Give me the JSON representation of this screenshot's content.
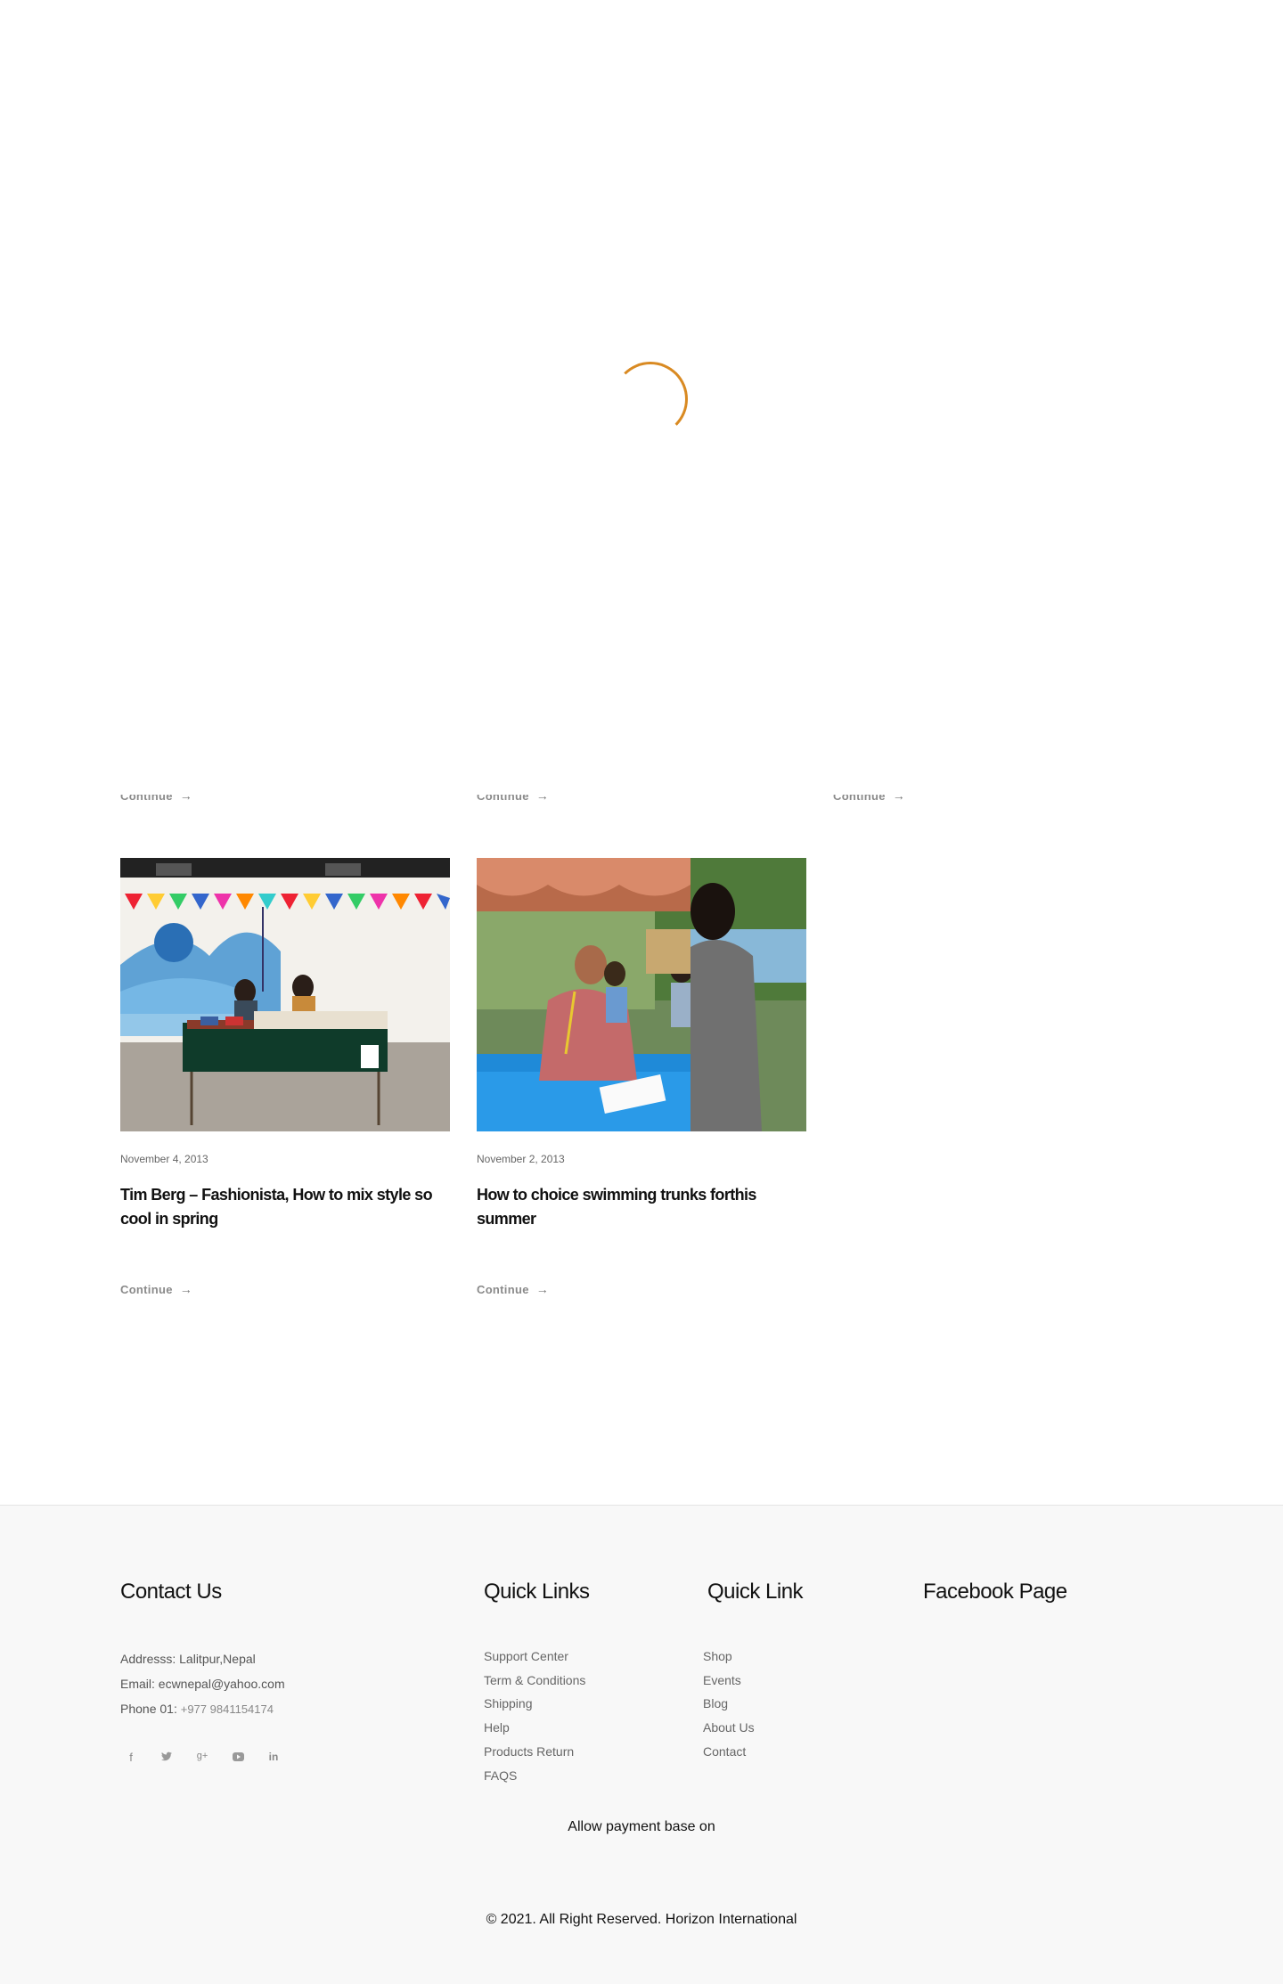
{
  "loader": {
    "color": "#d98a22"
  },
  "continue_label": "Continue",
  "arrow": "→",
  "posts": [
    {
      "date": "November 4, 2013",
      "title": "Tim Berg – Fashionista, How to mix style so cool in spring"
    },
    {
      "date": "November 2, 2013",
      "title": "How to choice swimming trunks forthis summer"
    }
  ],
  "footer": {
    "contact": {
      "heading": "Contact Us",
      "address": "Addresss: Lalitpur,Nepal",
      "email": "Email: ecwnepal@yahoo.com",
      "phone_label": "Phone 01:",
      "phone": "+977 9841154174"
    },
    "social": [
      "f",
      "🐦",
      "g+",
      "▶",
      "in"
    ],
    "quick_links": {
      "heading": "Quick Links",
      "items": [
        "Support Center",
        "Term & Conditions",
        "Shipping",
        "Help",
        "Products Return",
        "FAQS"
      ]
    },
    "quick_link": {
      "heading": "Quick Link",
      "items": [
        "Shop",
        "Events",
        "Blog",
        "About Us",
        "Contact"
      ]
    },
    "facebook": {
      "heading": "Facebook Page"
    },
    "payment": "Allow payment base on",
    "copyright": "© 2021. All Right Reserved. Horizon International"
  }
}
